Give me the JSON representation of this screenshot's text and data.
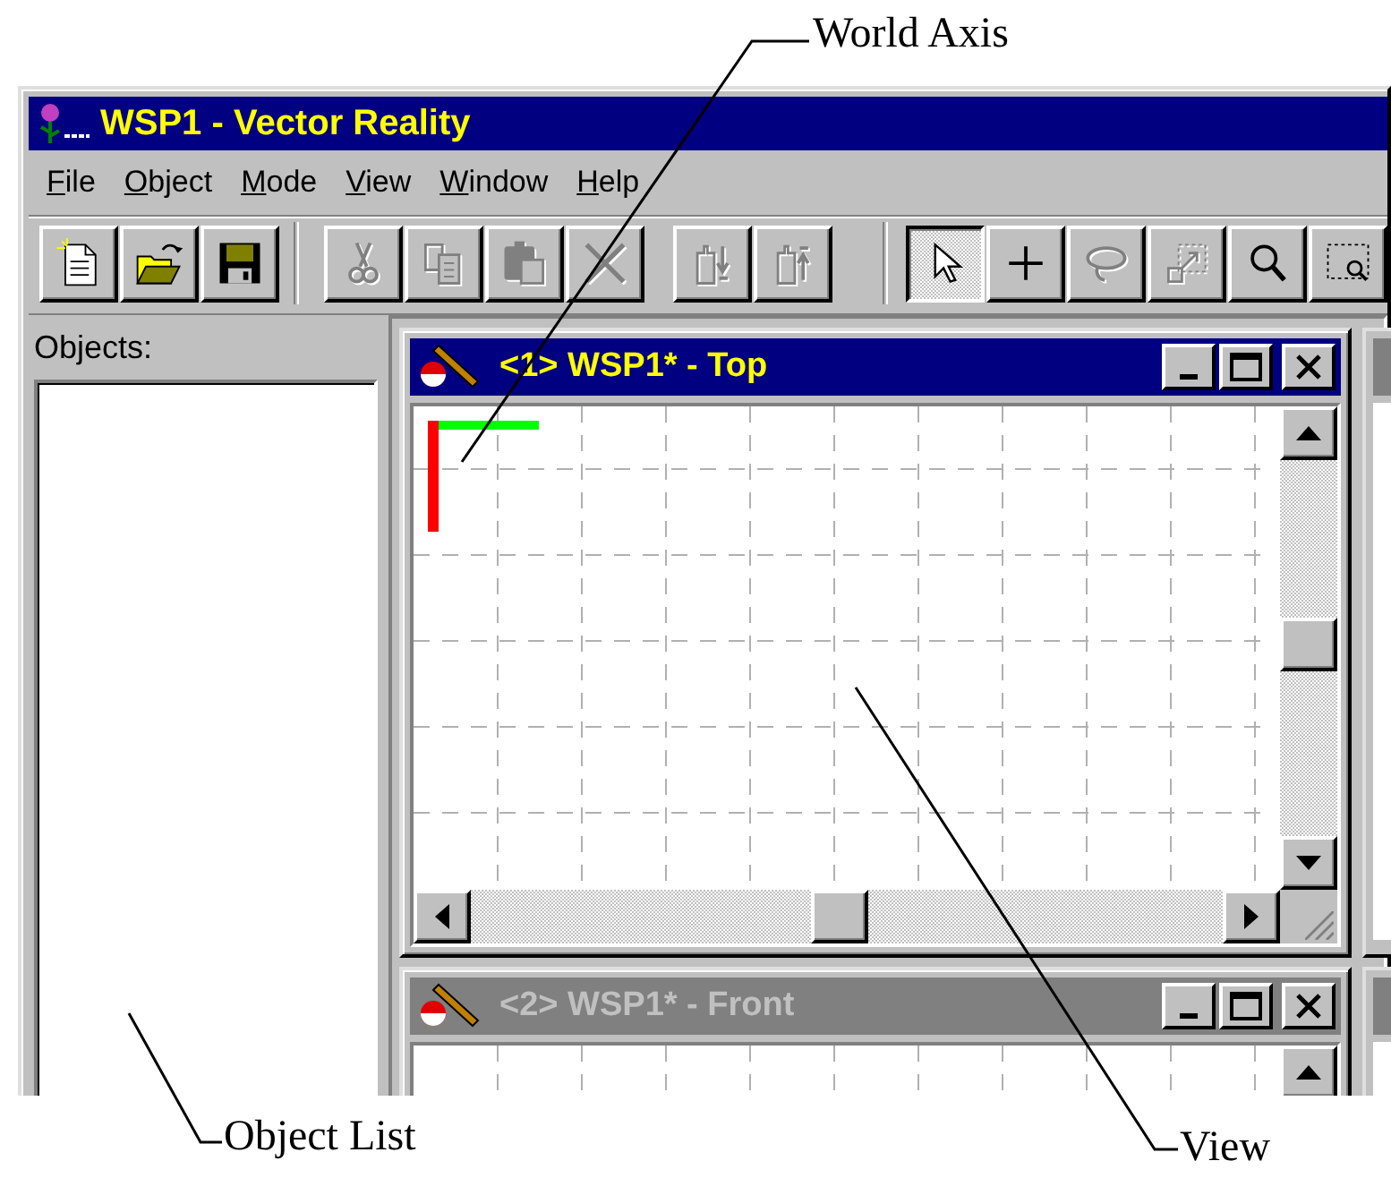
{
  "window": {
    "title": "WSP1 - Vector Reality"
  },
  "menu": [
    {
      "label": "File"
    },
    {
      "label": "Object"
    },
    {
      "label": "Mode"
    },
    {
      "label": "View"
    },
    {
      "label": "Window"
    },
    {
      "label": "Help"
    }
  ],
  "toolbar": {
    "groups": [
      {
        "buttons": [
          {
            "kind": "new",
            "disabled": false,
            "selected": false
          },
          {
            "kind": "open",
            "disabled": false,
            "selected": false
          },
          {
            "kind": "save",
            "disabled": false,
            "selected": false
          }
        ]
      },
      {
        "buttons": [
          {
            "kind": "cut",
            "disabled": true,
            "selected": false
          },
          {
            "kind": "copy",
            "disabled": true,
            "selected": false
          },
          {
            "kind": "paste",
            "disabled": true,
            "selected": false
          },
          {
            "kind": "delete",
            "disabled": true,
            "selected": false
          }
        ]
      },
      {
        "buttons": [
          {
            "kind": "down",
            "disabled": true,
            "selected": false
          },
          {
            "kind": "up",
            "disabled": true,
            "selected": false
          }
        ]
      },
      {
        "buttons": [
          {
            "kind": "pointer",
            "disabled": false,
            "selected": true
          },
          {
            "kind": "plus",
            "disabled": false,
            "selected": false
          },
          {
            "kind": "lasso",
            "disabled": true,
            "selected": false
          },
          {
            "kind": "region",
            "disabled": true,
            "selected": false
          },
          {
            "kind": "zoom",
            "disabled": false,
            "selected": false
          },
          {
            "kind": "zoombox",
            "disabled": false,
            "selected": false
          }
        ]
      }
    ]
  },
  "objects_pane": {
    "label": "Objects:"
  },
  "views": [
    {
      "title": "<1> WSP1* - Top",
      "active": true
    },
    {
      "title": "<2> WSP1* - Front",
      "active": false
    }
  ],
  "annotations": [
    {
      "text": "World Axis"
    },
    {
      "text": "Object List"
    },
    {
      "text": "View"
    }
  ]
}
